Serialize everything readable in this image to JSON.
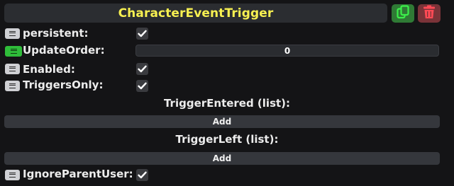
{
  "component": {
    "title": "CharacterEventTrigger",
    "duplicate_icon": "duplicate-icon",
    "delete_icon": "trash-icon",
    "colors": {
      "title": "#f7f051",
      "duplicate_bg": "#2f7a35",
      "delete_bg": "#7a3338",
      "active_menu": "#2fbd3a"
    }
  },
  "fields": {
    "persistent": {
      "label": "persistent:",
      "checked": true
    },
    "update_order": {
      "label": "UpdateOrder:",
      "value": "0"
    },
    "enabled": {
      "label": "Enabled:",
      "checked": true
    },
    "triggers_only": {
      "label": "TriggersOnly:",
      "checked": true
    },
    "trigger_entered": {
      "label": "TriggerEntered (list):",
      "add_label": "Add"
    },
    "trigger_left": {
      "label": "TriggerLeft (list):",
      "add_label": "Add"
    },
    "ignore_parent_user": {
      "label": "IgnoreParentUser:",
      "checked": true
    }
  }
}
